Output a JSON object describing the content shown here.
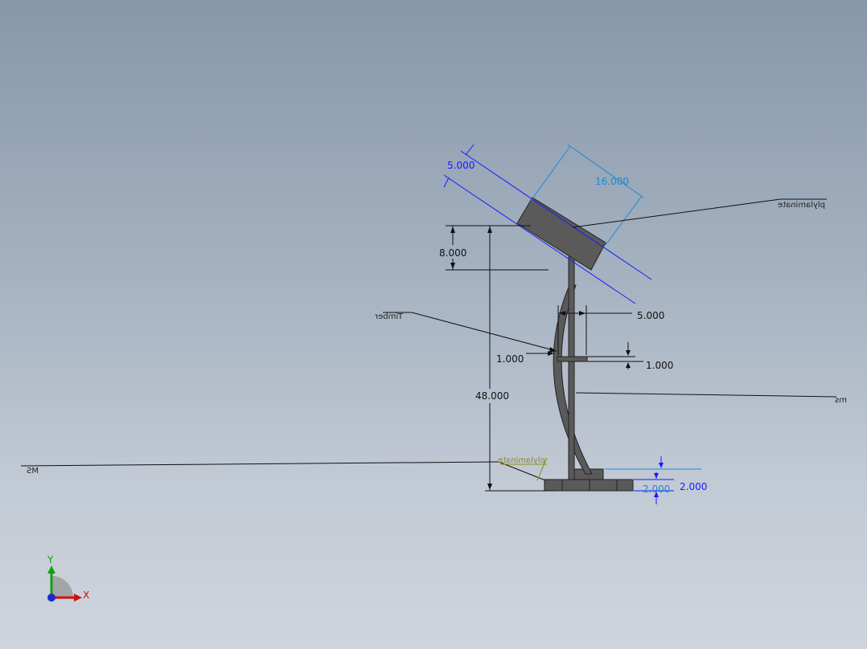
{
  "dimensions": {
    "panel_thickness": "5.000",
    "panel_width": "16.000",
    "panel_drop": "8.000",
    "total_height": "48.000",
    "arm_offset": "5.000",
    "rib_gap_left": "1.000",
    "rib_gap_right": "1.000",
    "base_height_a": "2.000",
    "base_height_b": "2.000"
  },
  "notes": {
    "panel_material": "plylaminate",
    "arc_material": "Timber",
    "pole_material": "ms",
    "base_material": "MS",
    "base_top_material": "plylaminate"
  },
  "triad": {
    "x_label": "X",
    "y_label": "Y"
  },
  "colors": {
    "dimension_blue": "#1a1aff",
    "dimension_cyan": "#1a8ad6",
    "dimension_black": "#111111",
    "part_fill": "#5a5a5a",
    "part_stroke": "#222222",
    "background_top": "#8797aa",
    "background_bottom": "#cfd5dd"
  }
}
